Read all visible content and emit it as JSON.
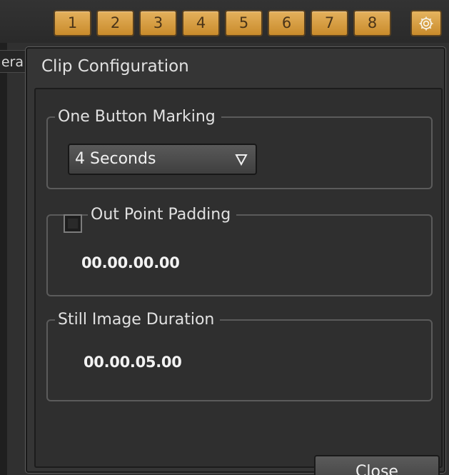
{
  "left_tab_stub": "era",
  "top_buttons": [
    "1",
    "2",
    "3",
    "4",
    "5",
    "6",
    "7",
    "8"
  ],
  "colors": {
    "accent_orange": "#d49b3c",
    "panel_bg": "#2f2f2f",
    "text": "#e1e1e1"
  },
  "icons": {
    "settings": "gear-icon",
    "dropdown": "chevron-down-icon"
  },
  "dialog": {
    "title": "Clip Configuration",
    "one_button_marking": {
      "label": "One Button Marking",
      "value": "4 Seconds"
    },
    "out_point_padding": {
      "label": "Out Point Padding",
      "value": "00.00.00.00",
      "checked": false
    },
    "still_image_duration": {
      "label": "Still Image Duration",
      "value": "00.00.05.00"
    },
    "close_label": "Close"
  }
}
